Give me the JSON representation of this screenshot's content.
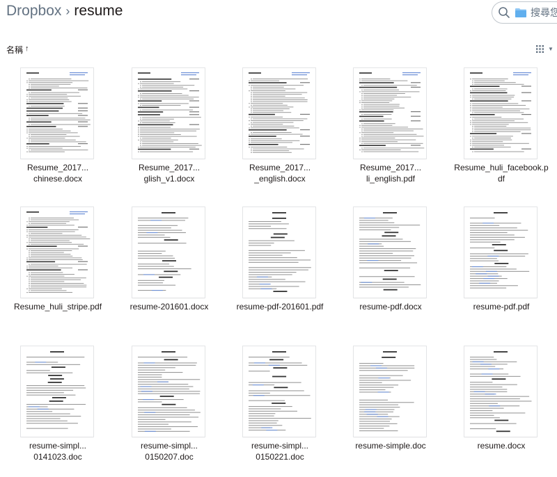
{
  "header": {
    "breadcrumb_root": "Dropbox",
    "breadcrumb_separator": "›",
    "breadcrumb_current": "resume",
    "search_placeholder": "搜尋您"
  },
  "toolbar": {
    "sort_label": "名稱",
    "sort_direction_icon": "arrow-up-icon",
    "view_icon": "grid-view-icon"
  },
  "files": [
    {
      "line1": "Resume_2017...",
      "line2": "chinese.docx",
      "style": "en"
    },
    {
      "line1": "Resume_2017...",
      "line2": "glish_v1.docx",
      "style": "en"
    },
    {
      "line1": "Resume_2017...",
      "line2": "_english.docx",
      "style": "en"
    },
    {
      "line1": "Resume_2017...",
      "line2": "li_english.pdf",
      "style": "en"
    },
    {
      "line1": "Resume_huli_facebook.p",
      "line2": "df",
      "style": "en"
    },
    {
      "line1": "Resume_huli_stripe.pdf",
      "line2": "",
      "style": "en"
    },
    {
      "line1": "resume-201601.docx",
      "line2": "",
      "style": "zh"
    },
    {
      "line1": "resume-pdf-201601.pdf",
      "line2": "",
      "style": "zh"
    },
    {
      "line1": "resume-pdf.docx",
      "line2": "",
      "style": "zh"
    },
    {
      "line1": "resume-pdf.pdf",
      "line2": "",
      "style": "zh"
    },
    {
      "line1": "resume-simpl...",
      "line2": "0141023.doc",
      "style": "zh"
    },
    {
      "line1": "resume-simpl...",
      "line2": "0150207.doc",
      "style": "zh"
    },
    {
      "line1": "resume-simpl...",
      "line2": "0150221.doc",
      "style": "zh"
    },
    {
      "line1": "resume-simple.doc",
      "line2": "",
      "style": "zh"
    },
    {
      "line1": "resume.docx",
      "line2": "",
      "style": "zh"
    }
  ]
}
